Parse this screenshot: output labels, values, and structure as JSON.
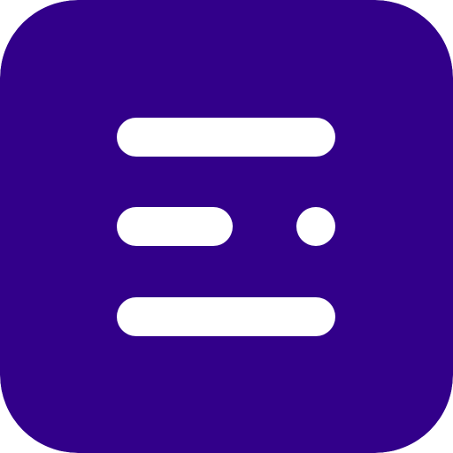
{
  "icon": {
    "name": "menu-lines-icon",
    "colors": {
      "background": "#32008a",
      "foreground": "#ffffff"
    }
  }
}
